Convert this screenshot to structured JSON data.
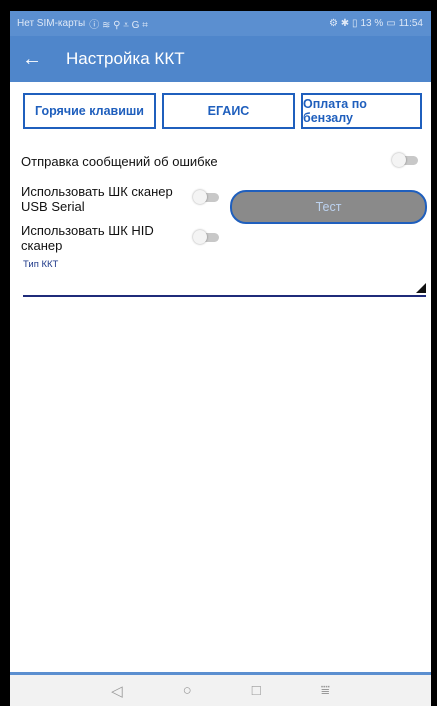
{
  "status_bar": {
    "carrier": "Нет SIM-карты",
    "status_icons_left": "ⓘ ≋ ⚲ ⩡ G ⌗",
    "status_icons_right": "⚙ ✱ ▯",
    "battery": "13 %",
    "time": "11:54"
  },
  "app_bar": {
    "back_icon": "←",
    "title": "Настройка ККТ"
  },
  "tabs": [
    {
      "label": "Горячие клавиши"
    },
    {
      "label": "ЕГАИС"
    },
    {
      "label": "Оплата по бензалу"
    }
  ],
  "settings": {
    "error_reporting_label": "Отправка сообщений об ошибке",
    "usb_scanner_label_line1": "Использовать ШК сканер",
    "usb_scanner_label_line2": "USB Serial",
    "hid_scanner_label_line1": "Использовать ШК HID",
    "hid_scanner_label_line2": "сканер",
    "test_button_label": "Тест",
    "kkt_type_label": "Тип ККТ",
    "kkt_type_value": ""
  },
  "nav": {
    "back": "◁",
    "home": "○",
    "recents": "□",
    "notifications": "⩸"
  }
}
